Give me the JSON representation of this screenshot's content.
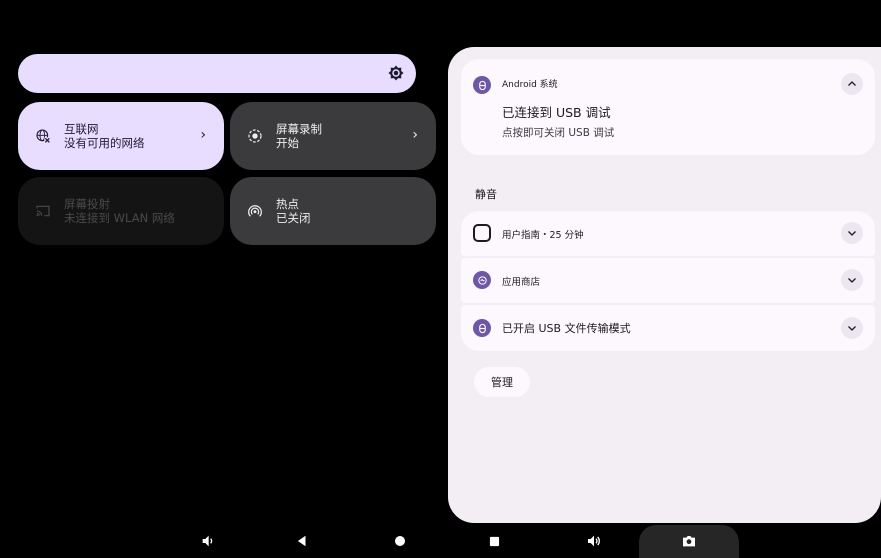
{
  "quick_settings": {
    "tiles": [
      {
        "title": "互联网",
        "subtitle": "没有可用的网络"
      },
      {
        "title": "屏幕录制",
        "subtitle": "开始"
      },
      {
        "title": "屏幕投射",
        "subtitle": "未连接到 WLAN 网络"
      },
      {
        "title": "热点",
        "subtitle": "已关闭"
      }
    ],
    "chevron": "›"
  },
  "notifications": {
    "main": {
      "app_name": "Android 系统",
      "title": "已连接到 USB 调试",
      "text": "点按即可关闭 USB 调试"
    },
    "silent_header": "静音",
    "silent_items": [
      {
        "label": "用户指南・25 分钟"
      },
      {
        "label": "应用商店"
      },
      {
        "label": "已开启 USB 文件传输模式"
      }
    ],
    "manage_label": "管理"
  },
  "colors": {
    "accent": "#6e58a6",
    "tile_active": "#e9ddff",
    "panel_bg": "#f3eef3"
  }
}
